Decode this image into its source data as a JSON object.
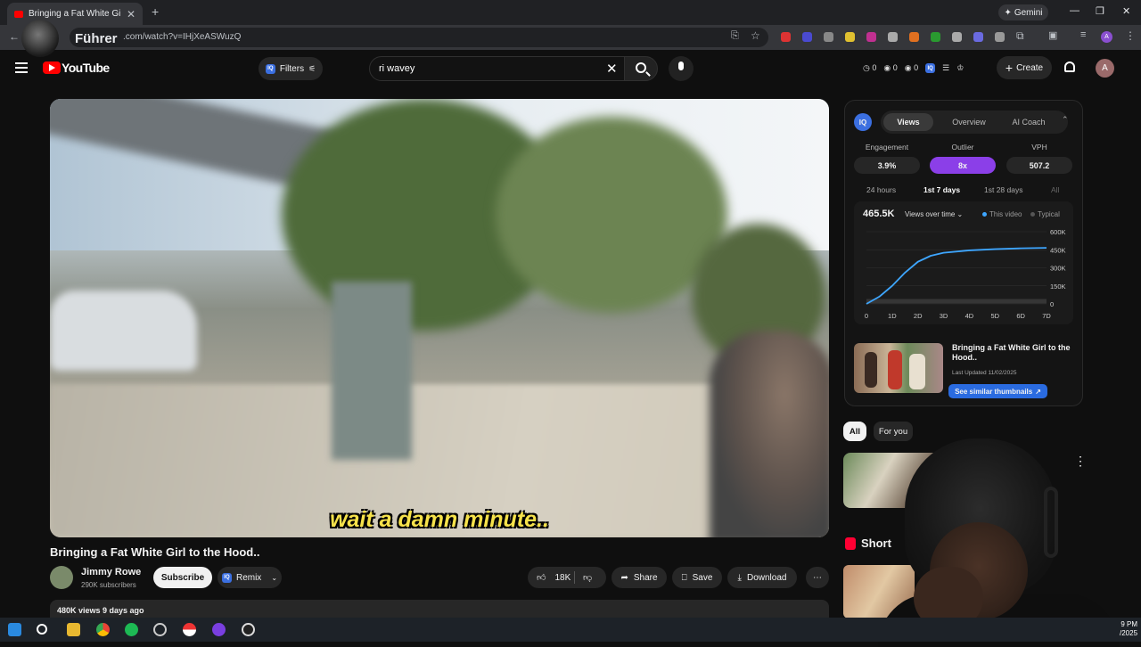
{
  "browser": {
    "tab_title": "Bringing a Fat White Girl to",
    "url": ".com/watch?v=IHjXeASWuzQ",
    "gemini_label": "Gemini",
    "overlay_name": "Führer",
    "profile_initial": "A"
  },
  "header": {
    "logo_text": "YouTube",
    "filters_label": "Filters",
    "search_value": "ri wavey",
    "mini_stats": [
      "0",
      "0",
      "0"
    ],
    "create_label": "Create",
    "account_initial": "A"
  },
  "video": {
    "caption": "wait a damn minute..",
    "title": "Bringing a Fat White Girl to the Hood..",
    "channel_name": "Jimmy Rowe",
    "subscribers": "290K subscribers",
    "subscribe_label": "Subscribe",
    "remix_label": "Remix",
    "likes": "18K",
    "share_label": "Share",
    "save_label": "Save",
    "download_label": "Download",
    "views_line": "480K views  9 days ago"
  },
  "panel": {
    "tabs": [
      "Views",
      "Overview",
      "AI Coach"
    ],
    "active_tab": "Views",
    "metrics": [
      {
        "label": "Engagement",
        "value": "3.9%"
      },
      {
        "label": "Outlier",
        "value": "8x"
      },
      {
        "label": "VPH",
        "value": "507.2"
      }
    ],
    "ranges": [
      "24 hours",
      "1st 7 days",
      "1st 28 days",
      "All"
    ],
    "active_range": "1st 7 days",
    "total_views": "465.5K",
    "views_dropdown": "Views over time",
    "legend_this": "This video",
    "legend_typical": "Typical",
    "thumb_title": "Bringing a Fat White Girl to the Hood..",
    "last_updated": "Last Updated 11/02/2025",
    "similar_label": "See similar thumbnails",
    "colors": {
      "accent": "#3b6fe0",
      "outlier": "#8b3fe8",
      "line": "#3ea6ff"
    }
  },
  "chart_data": {
    "type": "line",
    "title": "Views over time",
    "x_ticks": [
      "0",
      "1D",
      "2D",
      "3D",
      "4D",
      "5D",
      "6D",
      "7D"
    ],
    "y_ticks": [
      "600K",
      "450K",
      "300K",
      "150K",
      "0"
    ],
    "ylim": [
      0,
      600000
    ],
    "series": [
      {
        "name": "This video",
        "x": [
          0,
          0.5,
          1,
          1.5,
          2,
          2.5,
          3,
          4,
          5,
          6,
          7
        ],
        "values": [
          0,
          60000,
          150000,
          260000,
          350000,
          400000,
          425000,
          445000,
          455000,
          462000,
          465500
        ]
      },
      {
        "name": "Typical",
        "x": [
          0,
          7
        ],
        "values": [
          0,
          0
        ]
      }
    ]
  },
  "recommendations": {
    "chips": [
      "All",
      "For you"
    ],
    "shorts_label": "Short"
  },
  "taskbar": {
    "clock_time": "9 PM",
    "clock_date": "/2025"
  }
}
